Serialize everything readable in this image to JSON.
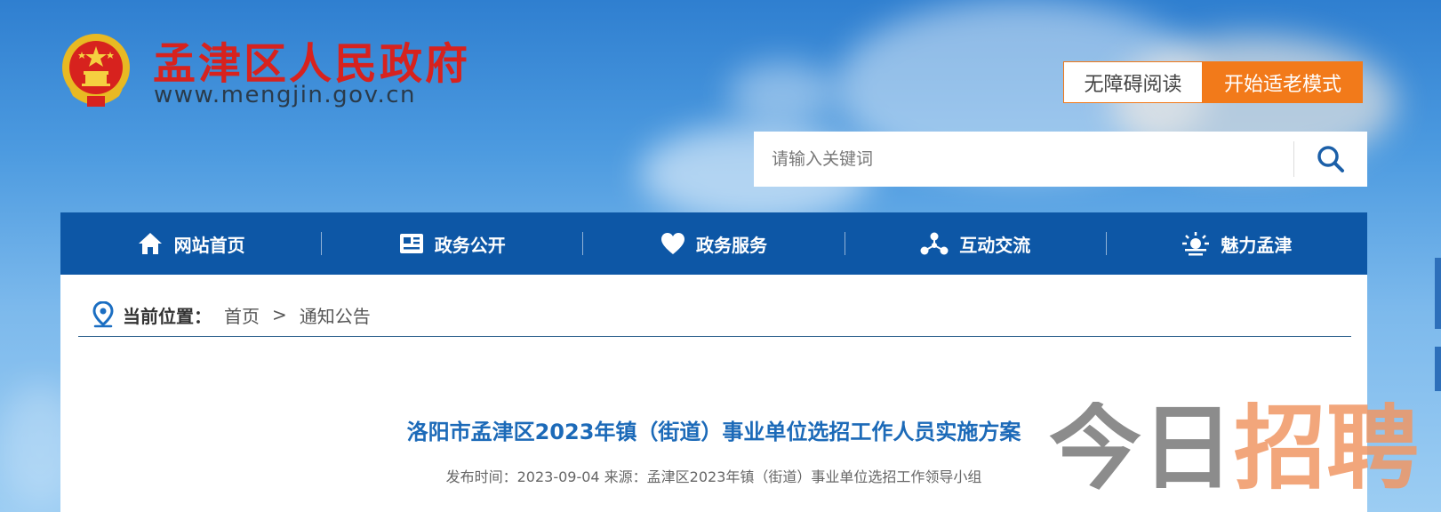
{
  "header": {
    "site_title": "孟津区人民政府",
    "site_url": "www.mengjin.gov.cn",
    "accessibility_label": "无障碍阅读",
    "elder_mode_label": "开始适老模式"
  },
  "search": {
    "placeholder": "请输入关键词",
    "icon": "search-icon"
  },
  "nav": {
    "items": [
      {
        "label": "网站首页",
        "icon": "home-icon"
      },
      {
        "label": "政务公开",
        "icon": "news-icon"
      },
      {
        "label": "政务服务",
        "icon": "heart-icon"
      },
      {
        "label": "互动交流",
        "icon": "network-icon"
      },
      {
        "label": "魅力孟津",
        "icon": "sunrise-icon"
      }
    ]
  },
  "breadcrumb": {
    "label": "当前位置：",
    "home": "首页",
    "separator": ">",
    "current": "通知公告"
  },
  "article": {
    "title": "洛阳市孟津区2023年镇（街道）事业单位选招工作人员实施方案",
    "meta": "发布时间：2023-09-04 来源：孟津区2023年镇（街道）事业单位选招工作领导小组"
  },
  "watermark": {
    "part1": "今日",
    "part2": "招聘"
  },
  "colors": {
    "nav_bg": "#0d57a6",
    "title_red": "#d7221e",
    "elder_orange": "#f27a1a",
    "article_title_blue": "#1c6ab8"
  }
}
